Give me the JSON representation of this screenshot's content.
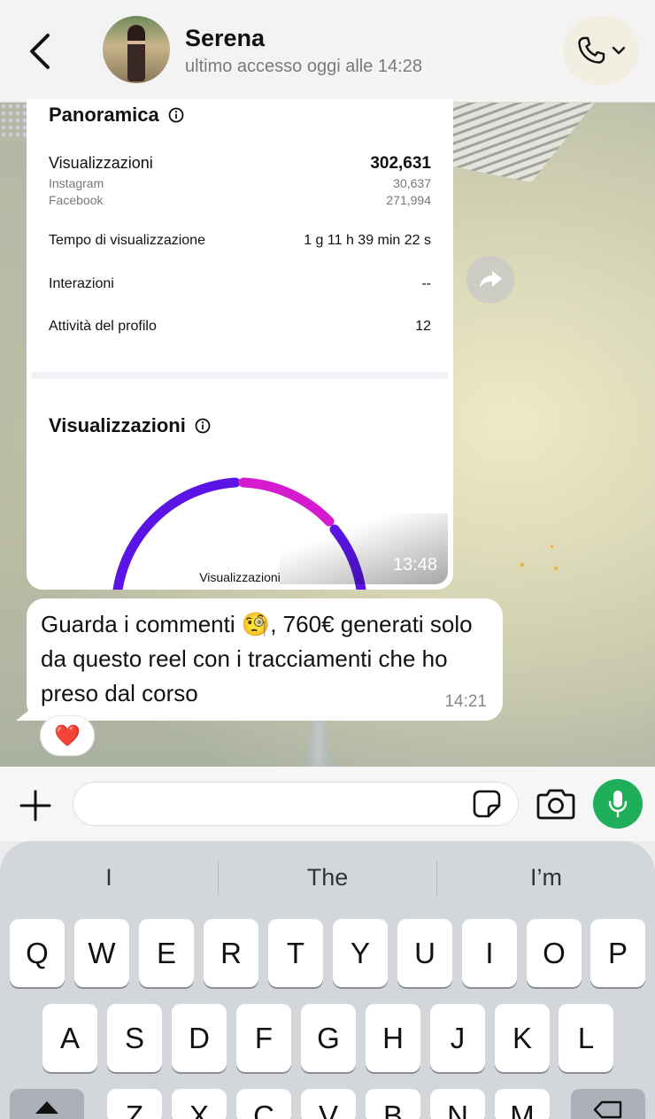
{
  "header": {
    "back_icon": "chevron-left-icon",
    "contact_name": "Serena",
    "contact_status": "ultimo accesso oggi alle 14:28",
    "call_icon": "phone-icon"
  },
  "media_message": {
    "overview": {
      "title": "Panoramica",
      "views_label": "Visualizzazioni",
      "views_value": "302,631",
      "instagram_label": "Instagram",
      "instagram_value": "30,637",
      "facebook_label": "Facebook",
      "facebook_value": "271,994",
      "watch_time_label": "Tempo di visualizzazione",
      "watch_time_value": "1 g 11 h 39 min 22 s",
      "interactions_label": "Interazioni",
      "interactions_value": "--",
      "profile_activity_label": "Attività del profilo",
      "profile_activity_value": "12"
    },
    "views_section": {
      "title": "Visualizzazioni",
      "gauge_label": "Visualizzazioni",
      "gauge_colors": [
        "#5a14e6",
        "#d61ad0",
        "#5a14e6"
      ]
    },
    "time": "13:48"
  },
  "text_message": {
    "text": "Guarda i commenti 🧐, 760€ generati solo da questo reel con i tracciamenti che ho preso dal corso",
    "time": "14:21",
    "reaction": "❤️"
  },
  "input_bar": {
    "value": "",
    "mic_color": "#1fae5a"
  },
  "keyboard": {
    "suggestions": [
      "I",
      "The",
      "I’m"
    ],
    "row1": [
      "Q",
      "W",
      "E",
      "R",
      "T",
      "Y",
      "U",
      "I",
      "O",
      "P"
    ],
    "row2": [
      "A",
      "S",
      "D",
      "F",
      "G",
      "H",
      "J",
      "K",
      "L"
    ],
    "row3": [
      "Z",
      "X",
      "C",
      "V",
      "B",
      "N",
      "M"
    ]
  }
}
